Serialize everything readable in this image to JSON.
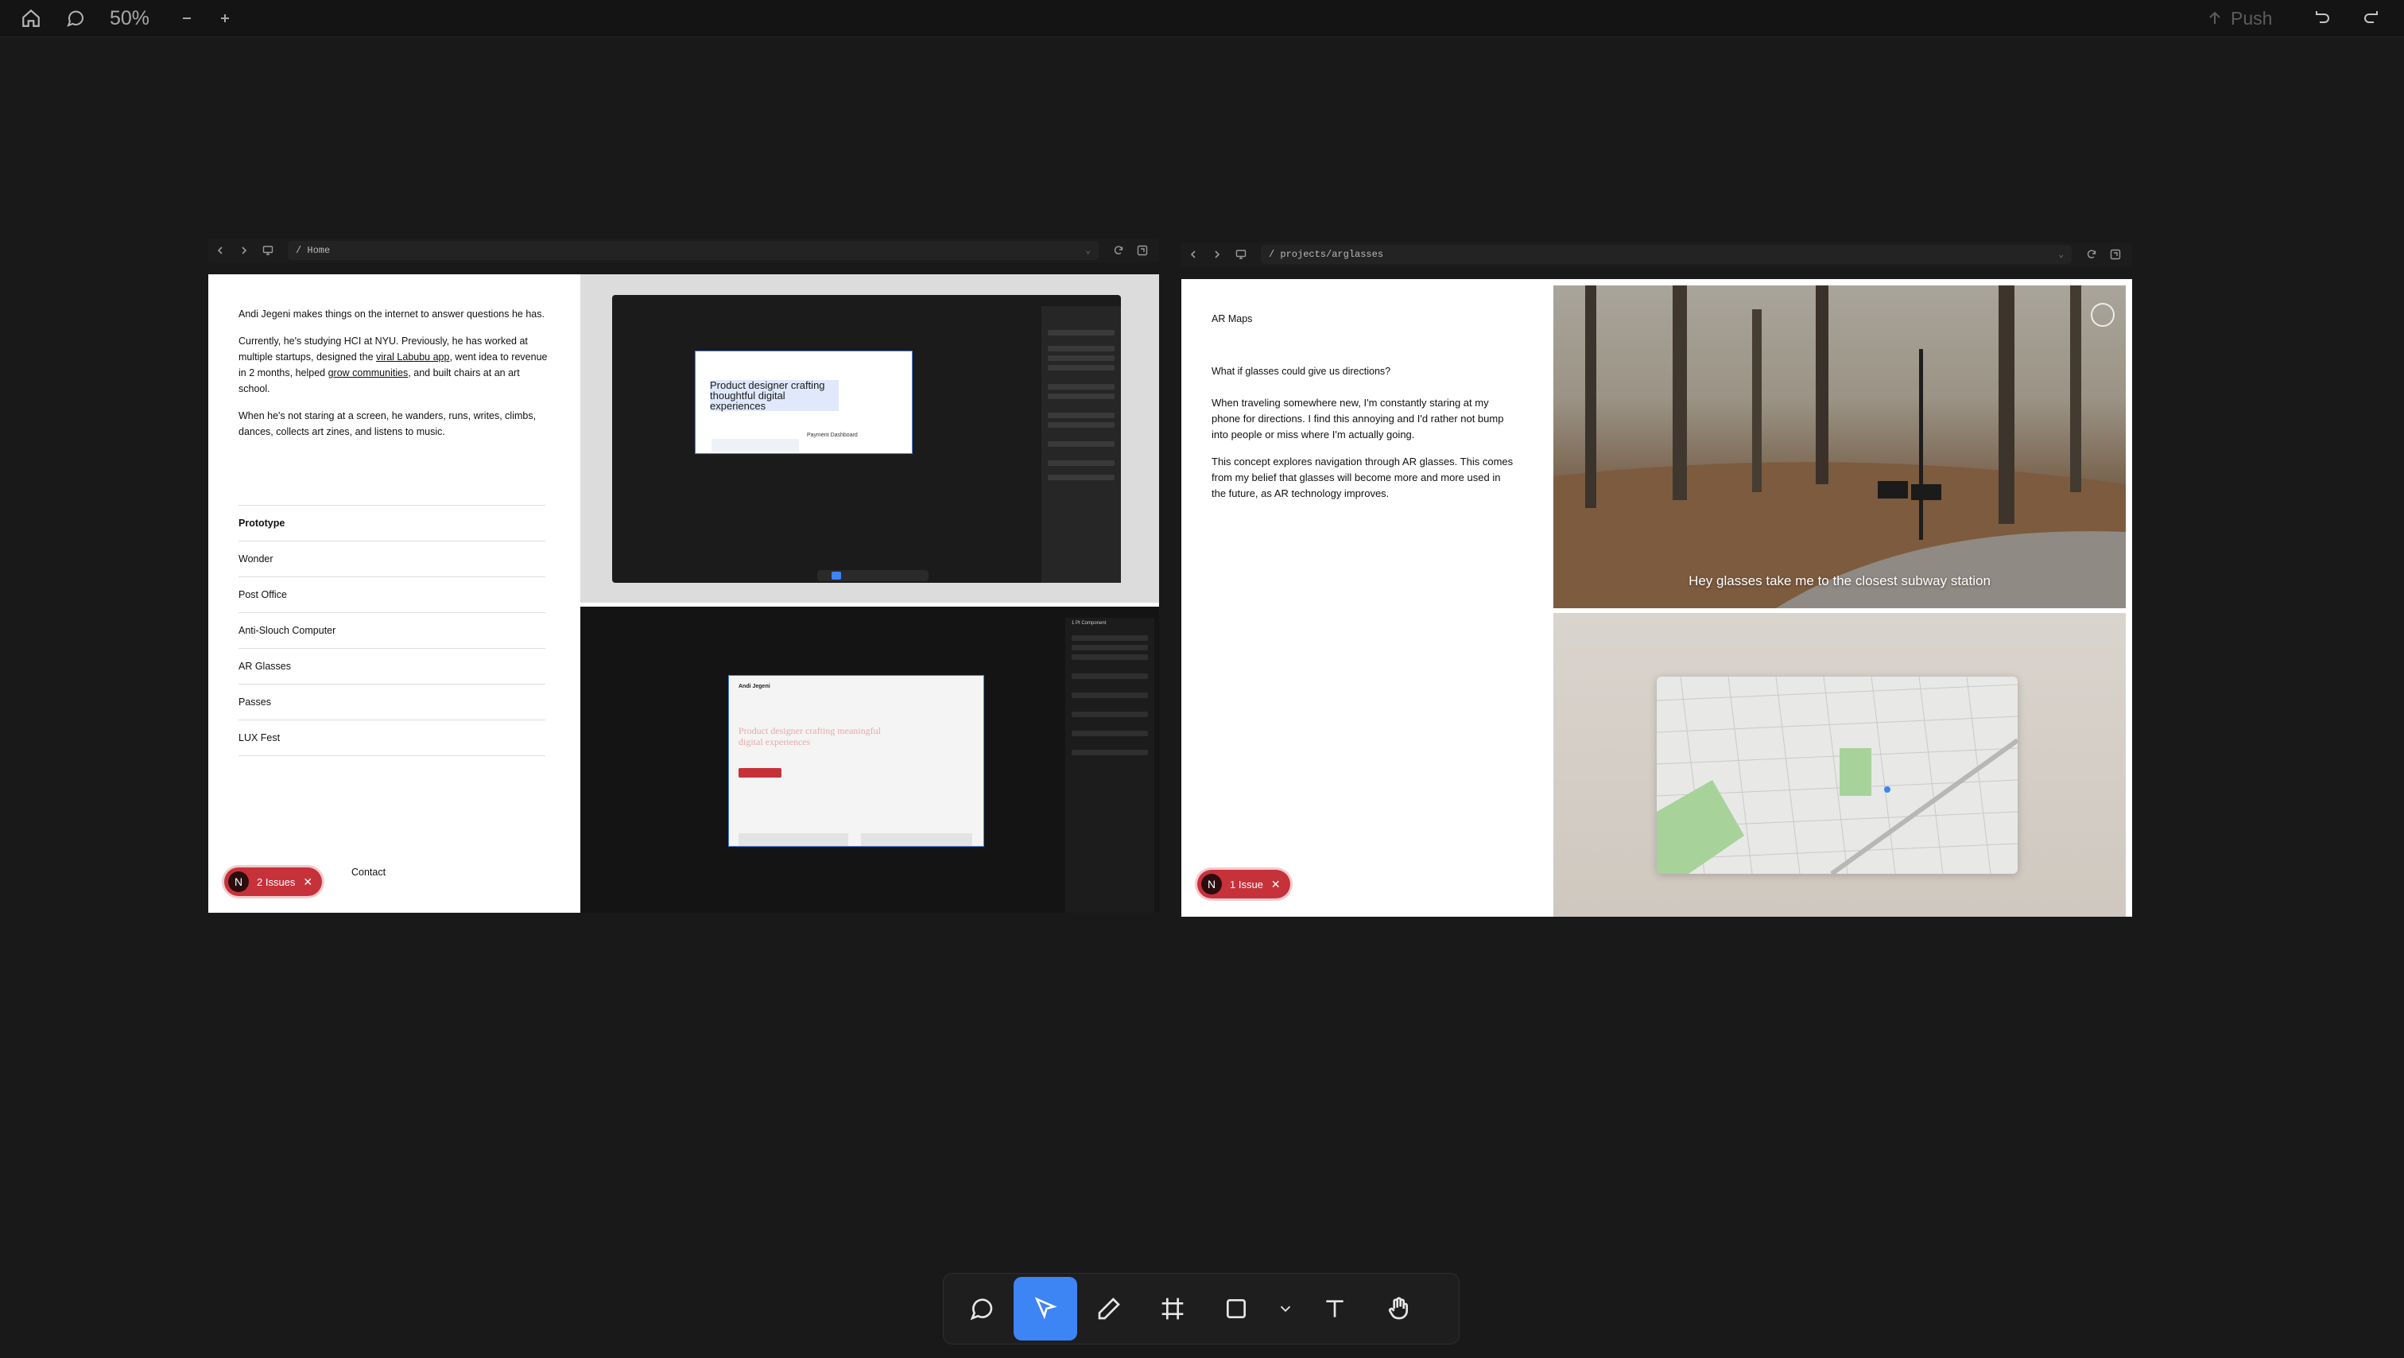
{
  "topbar": {
    "zoom": "50%",
    "push_label": "Push"
  },
  "left_frame": {
    "url": "/ Home",
    "bio": {
      "p1": "Andi Jegeni makes things on the internet to answer questions he has.",
      "p2_a": "Currently, he's studying HCI at NYU. Previously, he has worked at multiple startups, designed the ",
      "p2_link1": "viral Labubu app",
      "p2_b": ", went idea to revenue in 2 months, helped ",
      "p2_link2": "grow communities",
      "p2_c": ", and built chairs at an art school.",
      "p3": "When he's not staring at a screen, he wanders, runs, writes, climbs, dances, collects art zines, and listens to music."
    },
    "nav_items": [
      "Prototype",
      "Wonder",
      "Post Office",
      "Anti-Slouch Computer",
      "AR Glasses",
      "Passes",
      "LUX Fest"
    ],
    "contact": "Contact",
    "issues": {
      "avatar": "N",
      "label": "2 Issues"
    },
    "thumb1": {
      "headline": "Product designer crafting thoughtful digital experiences",
      "sub": "Payment Dashboard"
    },
    "thumb2": {
      "brand": "Andi Jegeni",
      "headline": "Product designer crafting meaningful digital experiences",
      "panel_title": "1 Pt Component"
    }
  },
  "right_frame": {
    "url": "/ projects/arglasses",
    "title": "AR Maps",
    "question": "What if glasses could give us directions?",
    "p1": "When traveling somewhere new, I'm constantly staring at my phone for directions. I find this annoying and I'd rather not bump into people or miss where I'm actually going.",
    "p2": "This concept explores navigation through AR glasses. This comes from my belief that glasses will become more and more used in the future, as AR technology improves.",
    "caption": "Hey glasses take me to the closest subway station",
    "issues": {
      "avatar": "N",
      "label": "1 Issue"
    }
  },
  "toolbar": {
    "tools": [
      "comment-tool",
      "select-tool",
      "pen-tool",
      "frame-tool",
      "rectangle-tool",
      "shape-dropdown",
      "text-tool",
      "hand-tool"
    ],
    "active": "select-tool"
  },
  "colors": {
    "accent": "#3d84f5",
    "issue_red": "#c7313a",
    "canvas": "#191919"
  }
}
